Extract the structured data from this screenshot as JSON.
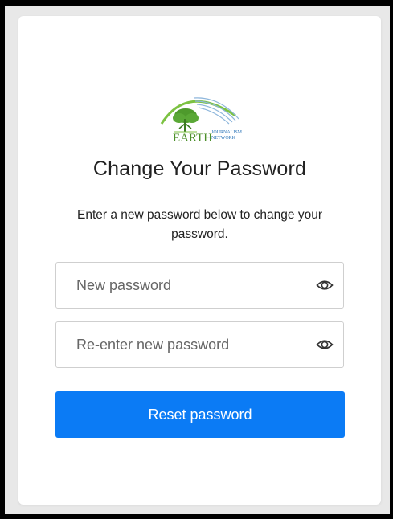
{
  "logo": {
    "brand": "EARTH",
    "line1": "JOURNALISM",
    "line2": "NETWORK",
    "green": "#7cc242",
    "blue": "#2d75b8"
  },
  "form": {
    "title": "Change Your Password",
    "description": "Enter a new password below to change your password.",
    "new_password": {
      "placeholder": "New password",
      "value": "",
      "toggle_icon": "eye-icon"
    },
    "reenter_password": {
      "placeholder": "Re-enter new password",
      "value": "",
      "toggle_icon": "eye-icon"
    },
    "submit_label": "Reset password"
  },
  "colors": {
    "accent": "#0b7bf5",
    "border": "#cfcfcf",
    "background": "#e8e8e8"
  }
}
